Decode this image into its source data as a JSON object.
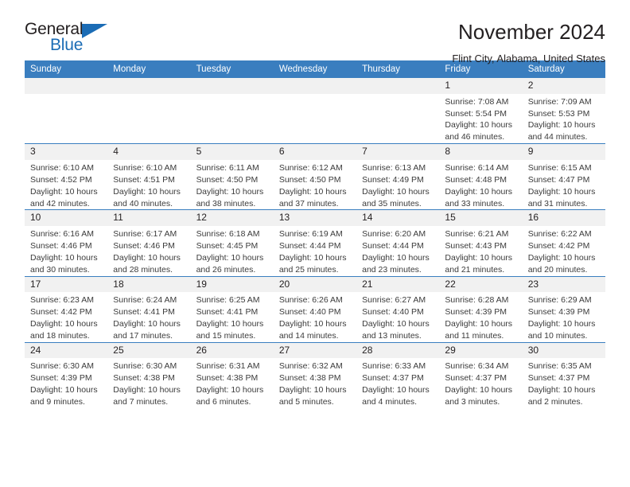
{
  "brand": {
    "name_part1": "General",
    "name_part2": "Blue",
    "accent_color": "#1b6cb5"
  },
  "header": {
    "month_title": "November 2024",
    "location": "Flint City, Alabama, United States"
  },
  "calendar": {
    "header_bg": "#3a7ebf",
    "daynum_bg": "#f1f1f1",
    "weekdays": [
      "Sunday",
      "Monday",
      "Tuesday",
      "Wednesday",
      "Thursday",
      "Friday",
      "Saturday"
    ],
    "weeks": [
      [
        {
          "day": "",
          "sunrise": "",
          "sunset": "",
          "daylight_line1": "",
          "daylight_line2": ""
        },
        {
          "day": "",
          "sunrise": "",
          "sunset": "",
          "daylight_line1": "",
          "daylight_line2": ""
        },
        {
          "day": "",
          "sunrise": "",
          "sunset": "",
          "daylight_line1": "",
          "daylight_line2": ""
        },
        {
          "day": "",
          "sunrise": "",
          "sunset": "",
          "daylight_line1": "",
          "daylight_line2": ""
        },
        {
          "day": "",
          "sunrise": "",
          "sunset": "",
          "daylight_line1": "",
          "daylight_line2": ""
        },
        {
          "day": "1",
          "sunrise": "Sunrise: 7:08 AM",
          "sunset": "Sunset: 5:54 PM",
          "daylight_line1": "Daylight: 10 hours",
          "daylight_line2": "and 46 minutes."
        },
        {
          "day": "2",
          "sunrise": "Sunrise: 7:09 AM",
          "sunset": "Sunset: 5:53 PM",
          "daylight_line1": "Daylight: 10 hours",
          "daylight_line2": "and 44 minutes."
        }
      ],
      [
        {
          "day": "3",
          "sunrise": "Sunrise: 6:10 AM",
          "sunset": "Sunset: 4:52 PM",
          "daylight_line1": "Daylight: 10 hours",
          "daylight_line2": "and 42 minutes."
        },
        {
          "day": "4",
          "sunrise": "Sunrise: 6:10 AM",
          "sunset": "Sunset: 4:51 PM",
          "daylight_line1": "Daylight: 10 hours",
          "daylight_line2": "and 40 minutes."
        },
        {
          "day": "5",
          "sunrise": "Sunrise: 6:11 AM",
          "sunset": "Sunset: 4:50 PM",
          "daylight_line1": "Daylight: 10 hours",
          "daylight_line2": "and 38 minutes."
        },
        {
          "day": "6",
          "sunrise": "Sunrise: 6:12 AM",
          "sunset": "Sunset: 4:50 PM",
          "daylight_line1": "Daylight: 10 hours",
          "daylight_line2": "and 37 minutes."
        },
        {
          "day": "7",
          "sunrise": "Sunrise: 6:13 AM",
          "sunset": "Sunset: 4:49 PM",
          "daylight_line1": "Daylight: 10 hours",
          "daylight_line2": "and 35 minutes."
        },
        {
          "day": "8",
          "sunrise": "Sunrise: 6:14 AM",
          "sunset": "Sunset: 4:48 PM",
          "daylight_line1": "Daylight: 10 hours",
          "daylight_line2": "and 33 minutes."
        },
        {
          "day": "9",
          "sunrise": "Sunrise: 6:15 AM",
          "sunset": "Sunset: 4:47 PM",
          "daylight_line1": "Daylight: 10 hours",
          "daylight_line2": "and 31 minutes."
        }
      ],
      [
        {
          "day": "10",
          "sunrise": "Sunrise: 6:16 AM",
          "sunset": "Sunset: 4:46 PM",
          "daylight_line1": "Daylight: 10 hours",
          "daylight_line2": "and 30 minutes."
        },
        {
          "day": "11",
          "sunrise": "Sunrise: 6:17 AM",
          "sunset": "Sunset: 4:46 PM",
          "daylight_line1": "Daylight: 10 hours",
          "daylight_line2": "and 28 minutes."
        },
        {
          "day": "12",
          "sunrise": "Sunrise: 6:18 AM",
          "sunset": "Sunset: 4:45 PM",
          "daylight_line1": "Daylight: 10 hours",
          "daylight_line2": "and 26 minutes."
        },
        {
          "day": "13",
          "sunrise": "Sunrise: 6:19 AM",
          "sunset": "Sunset: 4:44 PM",
          "daylight_line1": "Daylight: 10 hours",
          "daylight_line2": "and 25 minutes."
        },
        {
          "day": "14",
          "sunrise": "Sunrise: 6:20 AM",
          "sunset": "Sunset: 4:44 PM",
          "daylight_line1": "Daylight: 10 hours",
          "daylight_line2": "and 23 minutes."
        },
        {
          "day": "15",
          "sunrise": "Sunrise: 6:21 AM",
          "sunset": "Sunset: 4:43 PM",
          "daylight_line1": "Daylight: 10 hours",
          "daylight_line2": "and 21 minutes."
        },
        {
          "day": "16",
          "sunrise": "Sunrise: 6:22 AM",
          "sunset": "Sunset: 4:42 PM",
          "daylight_line1": "Daylight: 10 hours",
          "daylight_line2": "and 20 minutes."
        }
      ],
      [
        {
          "day": "17",
          "sunrise": "Sunrise: 6:23 AM",
          "sunset": "Sunset: 4:42 PM",
          "daylight_line1": "Daylight: 10 hours",
          "daylight_line2": "and 18 minutes."
        },
        {
          "day": "18",
          "sunrise": "Sunrise: 6:24 AM",
          "sunset": "Sunset: 4:41 PM",
          "daylight_line1": "Daylight: 10 hours",
          "daylight_line2": "and 17 minutes."
        },
        {
          "day": "19",
          "sunrise": "Sunrise: 6:25 AM",
          "sunset": "Sunset: 4:41 PM",
          "daylight_line1": "Daylight: 10 hours",
          "daylight_line2": "and 15 minutes."
        },
        {
          "day": "20",
          "sunrise": "Sunrise: 6:26 AM",
          "sunset": "Sunset: 4:40 PM",
          "daylight_line1": "Daylight: 10 hours",
          "daylight_line2": "and 14 minutes."
        },
        {
          "day": "21",
          "sunrise": "Sunrise: 6:27 AM",
          "sunset": "Sunset: 4:40 PM",
          "daylight_line1": "Daylight: 10 hours",
          "daylight_line2": "and 13 minutes."
        },
        {
          "day": "22",
          "sunrise": "Sunrise: 6:28 AM",
          "sunset": "Sunset: 4:39 PM",
          "daylight_line1": "Daylight: 10 hours",
          "daylight_line2": "and 11 minutes."
        },
        {
          "day": "23",
          "sunrise": "Sunrise: 6:29 AM",
          "sunset": "Sunset: 4:39 PM",
          "daylight_line1": "Daylight: 10 hours",
          "daylight_line2": "and 10 minutes."
        }
      ],
      [
        {
          "day": "24",
          "sunrise": "Sunrise: 6:30 AM",
          "sunset": "Sunset: 4:39 PM",
          "daylight_line1": "Daylight: 10 hours",
          "daylight_line2": "and 9 minutes."
        },
        {
          "day": "25",
          "sunrise": "Sunrise: 6:30 AM",
          "sunset": "Sunset: 4:38 PM",
          "daylight_line1": "Daylight: 10 hours",
          "daylight_line2": "and 7 minutes."
        },
        {
          "day": "26",
          "sunrise": "Sunrise: 6:31 AM",
          "sunset": "Sunset: 4:38 PM",
          "daylight_line1": "Daylight: 10 hours",
          "daylight_line2": "and 6 minutes."
        },
        {
          "day": "27",
          "sunrise": "Sunrise: 6:32 AM",
          "sunset": "Sunset: 4:38 PM",
          "daylight_line1": "Daylight: 10 hours",
          "daylight_line2": "and 5 minutes."
        },
        {
          "day": "28",
          "sunrise": "Sunrise: 6:33 AM",
          "sunset": "Sunset: 4:37 PM",
          "daylight_line1": "Daylight: 10 hours",
          "daylight_line2": "and 4 minutes."
        },
        {
          "day": "29",
          "sunrise": "Sunrise: 6:34 AM",
          "sunset": "Sunset: 4:37 PM",
          "daylight_line1": "Daylight: 10 hours",
          "daylight_line2": "and 3 minutes."
        },
        {
          "day": "30",
          "sunrise": "Sunrise: 6:35 AM",
          "sunset": "Sunset: 4:37 PM",
          "daylight_line1": "Daylight: 10 hours",
          "daylight_line2": "and 2 minutes."
        }
      ]
    ]
  }
}
